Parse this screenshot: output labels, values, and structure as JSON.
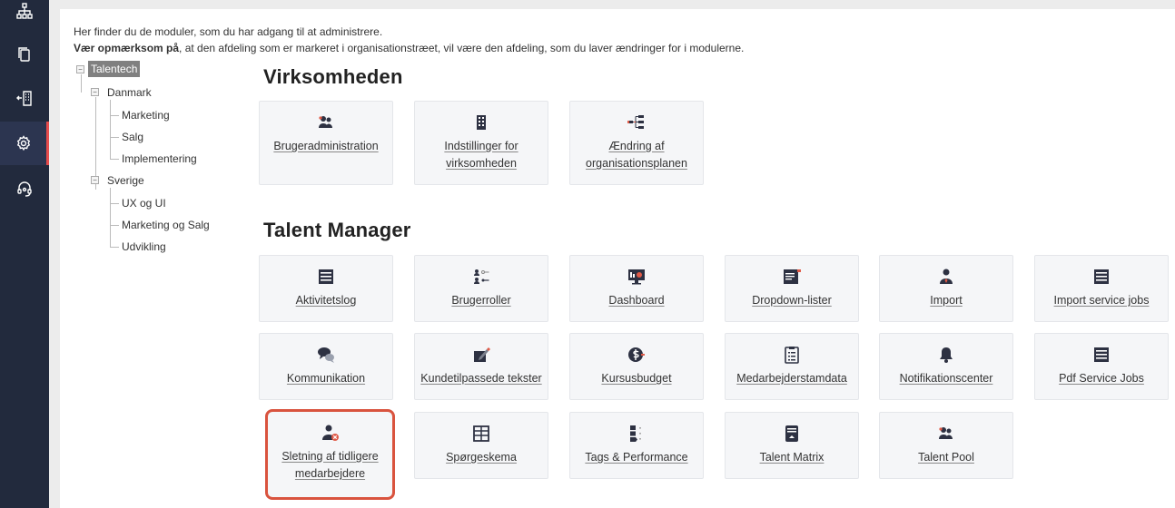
{
  "sidebar": {
    "items": [
      {
        "icon": "org-chart-icon"
      },
      {
        "icon": "copy-icon"
      },
      {
        "icon": "building-exit-icon"
      },
      {
        "icon": "gear-icon",
        "active": true
      },
      {
        "icon": "headset-icon"
      }
    ],
    "accent": "#e74c4c"
  },
  "intro": {
    "line1": "Her finder du de moduler, som du har adgang til at administrere.",
    "line2_bold": "Vær opmærksom på",
    "line2_rest": ", at den afdeling som er markeret i organisationstræet, vil være den afdeling, som du laver ændringer for i modulerne."
  },
  "tree": {
    "root": "Talentech",
    "danmark": "Danmark",
    "danmark_children": [
      "Marketing",
      "Salg",
      "Implementering"
    ],
    "sverige": "Sverige",
    "sverige_children": [
      "UX og UI",
      "Marketing og Salg",
      "Udvikling"
    ]
  },
  "sections": {
    "virksomheden": {
      "title": "Virksomheden",
      "tiles": [
        {
          "label": "Brugeradministration",
          "icon": "users-admin-icon"
        },
        {
          "label": "Indstillinger for virksomheden",
          "icon": "building-icon"
        },
        {
          "label": "Ændring af organisationsplanen",
          "icon": "org-tree-icon"
        }
      ]
    },
    "talent_manager": {
      "title": "Talent Manager",
      "tiles": [
        {
          "label": "Aktivitetslog",
          "icon": "list-icon"
        },
        {
          "label": "Brugerroller",
          "icon": "user-roles-icon"
        },
        {
          "label": "Dashboard",
          "icon": "dashboard-icon"
        },
        {
          "label": "Dropdown-lister",
          "icon": "dropdown-list-icon"
        },
        {
          "label": "Import",
          "icon": "import-user-icon"
        },
        {
          "label": "Import service jobs",
          "icon": "list-icon"
        },
        {
          "label": "Kommunikation",
          "icon": "chat-icon"
        },
        {
          "label": "Kundetilpassede tekster",
          "icon": "edit-icon"
        },
        {
          "label": "Kursusbudget",
          "icon": "budget-icon"
        },
        {
          "label": "Medarbejderstamdata",
          "icon": "clipboard-icon"
        },
        {
          "label": "Notifikationscenter",
          "icon": "bell-icon"
        },
        {
          "label": "Pdf Service Jobs",
          "icon": "list-icon"
        },
        {
          "label": "Sletning af tidligere medarbejdere",
          "icon": "remove-user-icon",
          "highlight": true
        },
        {
          "label": "Spørgeskema",
          "icon": "table-icon"
        },
        {
          "label": "Tags & Performance",
          "icon": "tags-icon"
        },
        {
          "label": "Talent Matrix",
          "icon": "matrix-icon"
        },
        {
          "label": "Talent Pool",
          "icon": "talent-pool-icon"
        }
      ]
    }
  },
  "colors": {
    "sidebar_bg": "#222a3d",
    "highlight_border": "#d9533e",
    "tile_bg": "#f5f6f8"
  }
}
